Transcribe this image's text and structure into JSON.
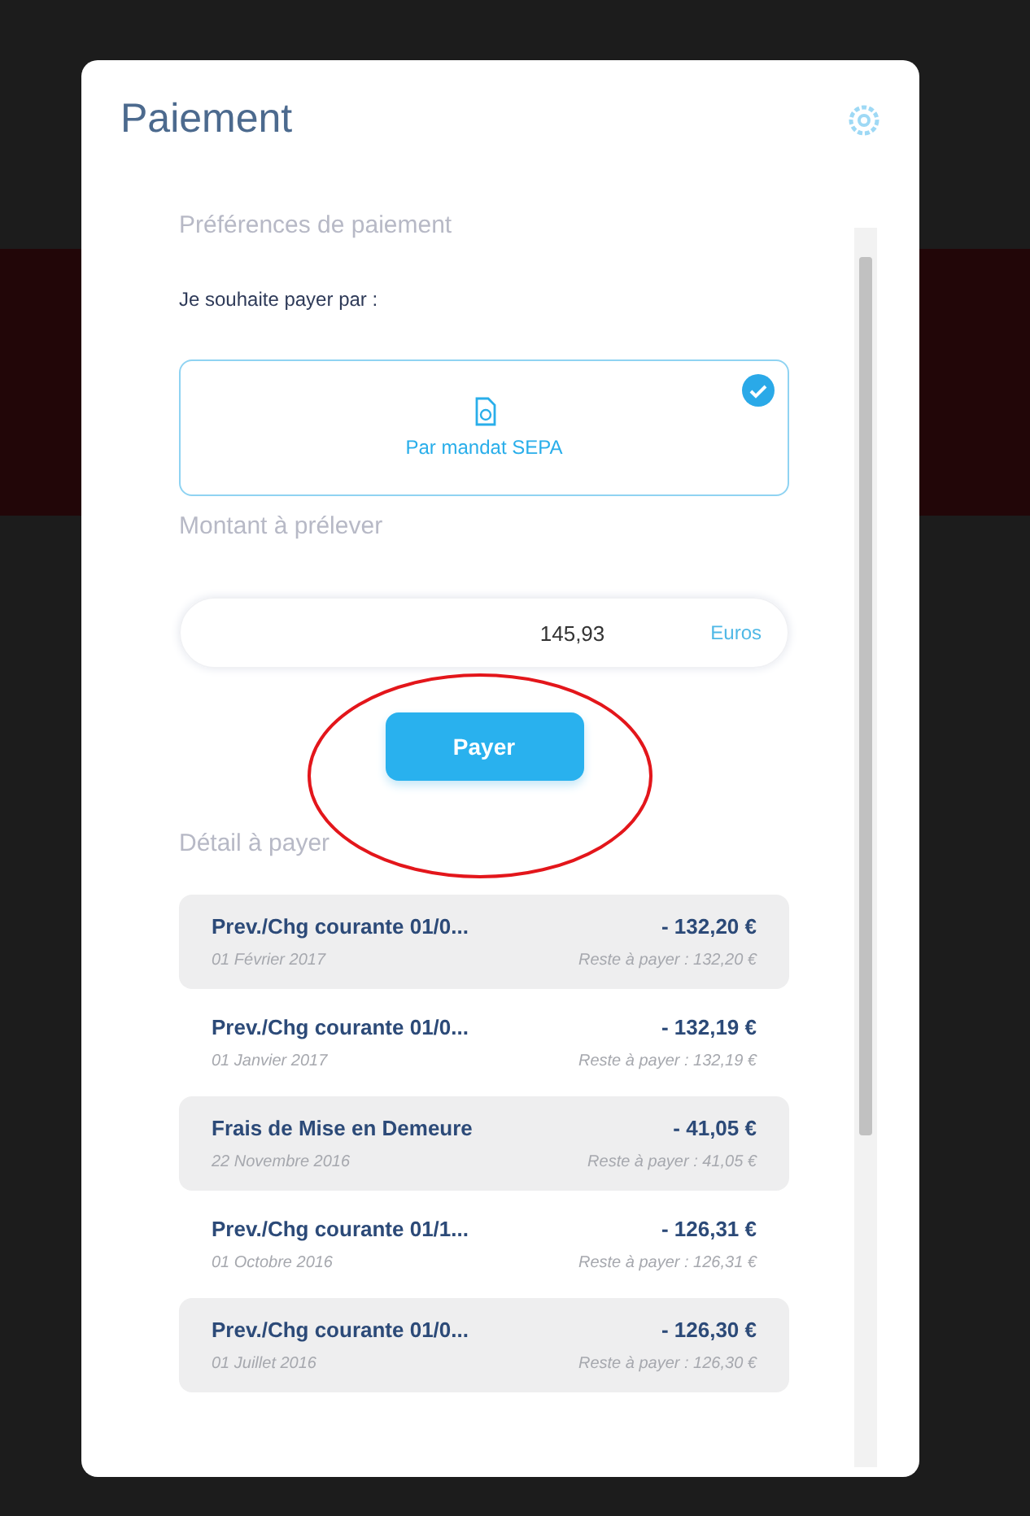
{
  "dialog": {
    "title": "Paiement"
  },
  "preferences": {
    "heading": "Préférences de paiement",
    "prompt": "Je souhaite payer par :",
    "methods": [
      {
        "label": "Par mandat SEPA",
        "selected": true
      }
    ]
  },
  "amount": {
    "label": "Montant à prélever",
    "value": "145,93",
    "unit": "Euros"
  },
  "pay_button": "Payer",
  "details": {
    "heading": "Détail à payer",
    "items": [
      {
        "title": "Prev./Chg courante 01/0...",
        "amount": "- 132,20 €",
        "date": "01 Février 2017",
        "remaining": "Reste à payer : 132,20 €"
      },
      {
        "title": "Prev./Chg courante 01/0...",
        "amount": "- 132,19 €",
        "date": "01 Janvier 2017",
        "remaining": "Reste à payer : 132,19 €"
      },
      {
        "title": "Frais de Mise en Demeure",
        "amount": "- 41,05 €",
        "date": "22 Novembre 2016",
        "remaining": "Reste à payer : 41,05 €"
      },
      {
        "title": "Prev./Chg courante 01/1...",
        "amount": "- 126,31 €",
        "date": "01 Octobre 2016",
        "remaining": "Reste à payer : 126,31 €"
      },
      {
        "title": "Prev./Chg courante 01/0...",
        "amount": "- 126,30 €",
        "date": "01 Juillet 2016",
        "remaining": "Reste à payer : 126,30 €"
      }
    ]
  }
}
